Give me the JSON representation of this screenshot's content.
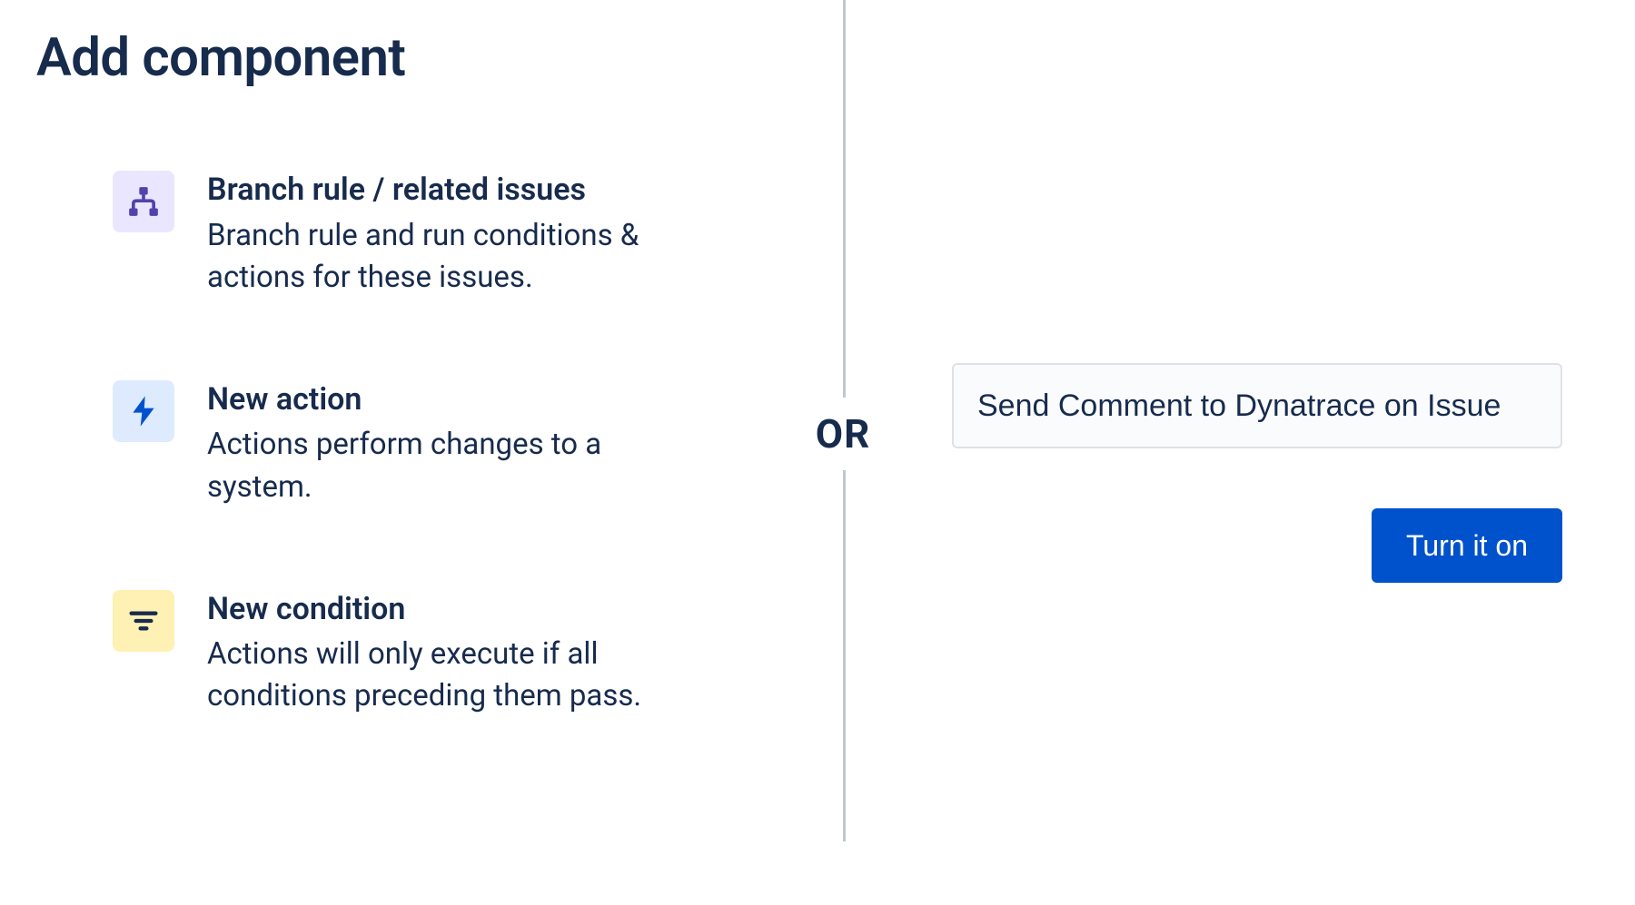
{
  "page": {
    "title": "Add component",
    "or_label": "OR"
  },
  "components": [
    {
      "icon": "branch",
      "title": "Branch rule / related issues",
      "desc": "Branch rule and run conditions & actions for these issues."
    },
    {
      "icon": "action",
      "title": "New action",
      "desc": "Actions perform changes to a system."
    },
    {
      "icon": "condition",
      "title": "New condition",
      "desc": "Actions will only execute if all conditions preceding them pass."
    }
  ],
  "right": {
    "rule_name_value": "Send Comment to Dynatrace on Issue",
    "turn_on_label": "Turn it on"
  }
}
